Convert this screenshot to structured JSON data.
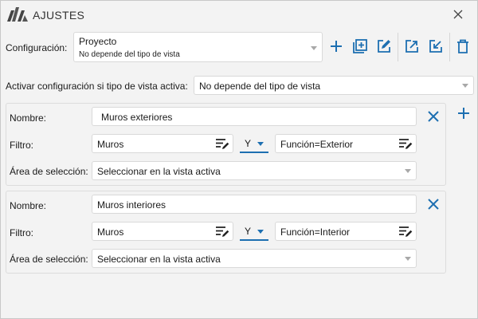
{
  "window": {
    "title": "AJUSTES"
  },
  "config": {
    "label": "Configuración:",
    "selected_name": "Proyecto",
    "selected_desc": "No depende del tipo de vista"
  },
  "activation": {
    "label": "Activar configuración si tipo de vista activa:",
    "value": "No depende del tipo de vista"
  },
  "rules": [
    {
      "name_label": "Nombre:",
      "name_value": "Muros exteriores",
      "filter_label": "Filtro:",
      "filter_category": "Muros",
      "operator": "Y",
      "filter_condition": "Función=Exterior",
      "area_label": "Área de selección:",
      "area_value": "Seleccionar en la vista activa"
    },
    {
      "name_label": "Nombre:",
      "name_value": "Muros interiores",
      "filter_label": "Filtro:",
      "filter_category": "Muros",
      "operator": "Y",
      "filter_condition": "Función=Interior",
      "area_label": "Área de selección:",
      "area_value": "Seleccionar en la vista activa"
    }
  ],
  "colors": {
    "accent": "#1d6fb1"
  },
  "icons": {
    "logo": "app-logo-icon",
    "close": "close-icon",
    "add": "plus-icon",
    "duplicate": "duplicate-icon",
    "edit": "edit-icon",
    "export": "export-icon",
    "import": "import-icon",
    "delete": "trash-icon",
    "filter_edit": "filter-edit-icon",
    "remove_rule": "remove-x-icon"
  }
}
